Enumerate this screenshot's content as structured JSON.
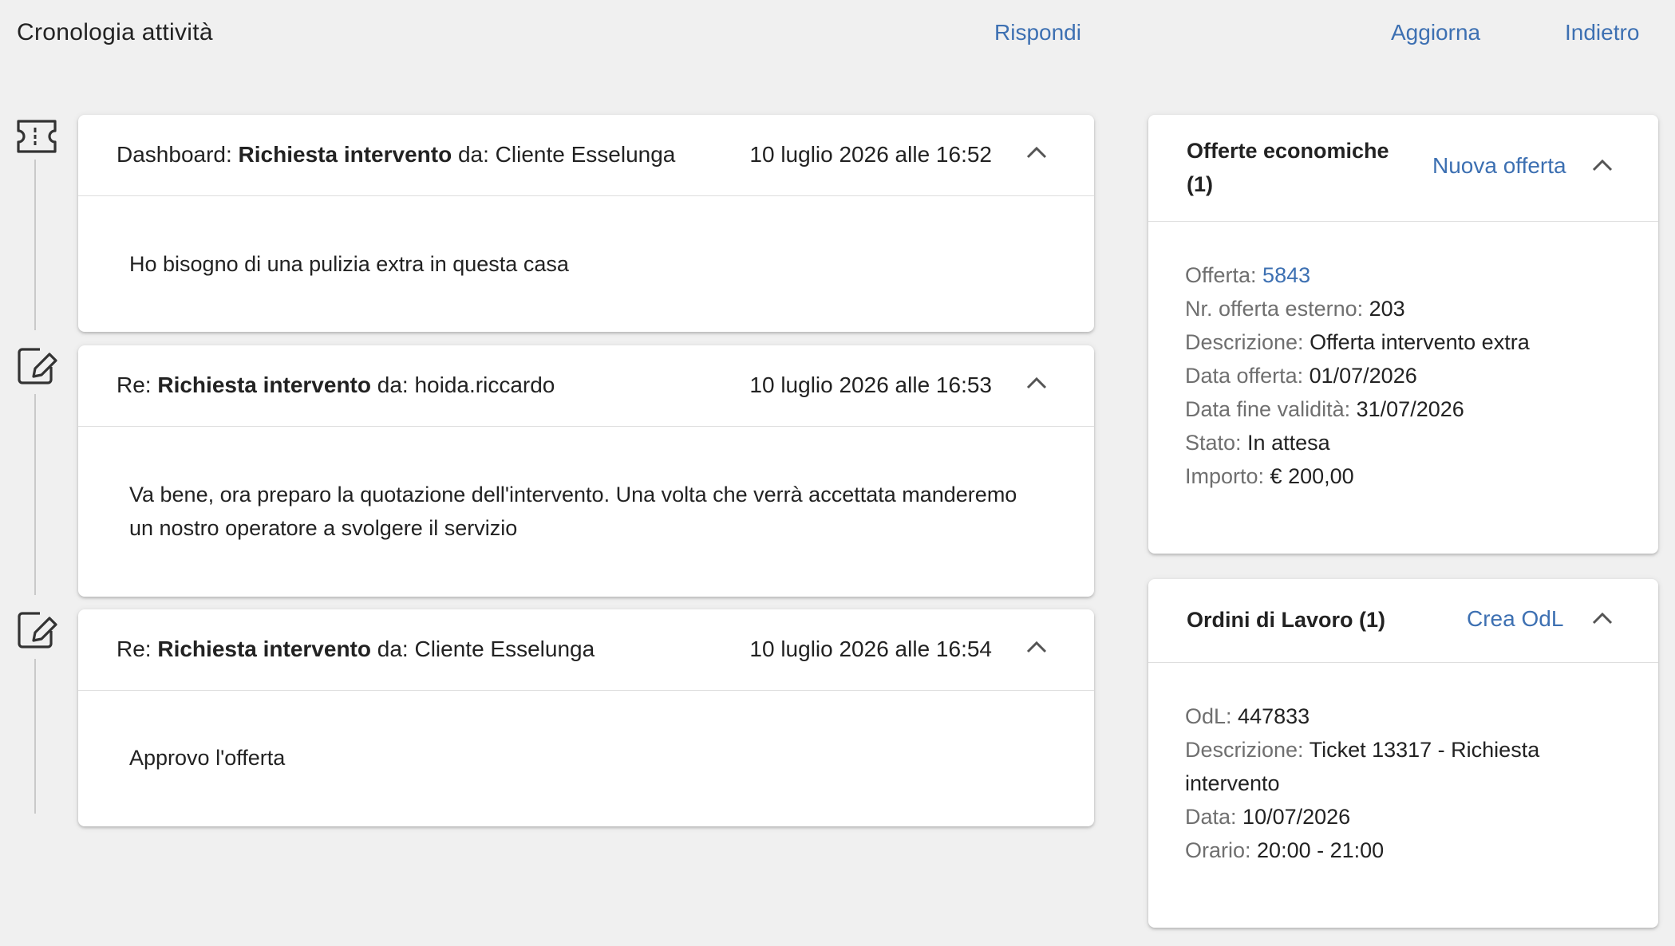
{
  "header": {
    "title": "Cronologia attività",
    "reply_label": "Rispondi",
    "refresh_label": "Aggiorna",
    "back_label": "Indietro"
  },
  "messages": [
    {
      "icon": "ticket-icon",
      "prefix": "Dashboard: ",
      "subject": "Richiesta intervento",
      "from_label": " da: ",
      "from": "Cliente Esselunga",
      "date": "10 luglio 2026 alle 16:52",
      "body": "Ho bisogno di una pulizia extra in questa casa"
    },
    {
      "icon": "edit-note-icon",
      "prefix": "Re: ",
      "subject": "Richiesta intervento",
      "from_label": " da: ",
      "from": "hoida.riccardo",
      "date": "10 luglio 2026 alle 16:53",
      "body": "Va bene, ora preparo la quotazione dell'intervento. Una volta che verrà accettata manderemo un nostro operatore a svolgere il servizio"
    },
    {
      "icon": "edit-note-icon",
      "prefix": "Re: ",
      "subject": "Richiesta intervento",
      "from_label": " da: ",
      "from": "Cliente Esselunga",
      "date": "10 luglio 2026 alle 16:54",
      "body": "Approvo l'offerta"
    }
  ],
  "offers": {
    "title": "Offerte economiche (1)",
    "action_label": "Nuova offerta",
    "fields": [
      {
        "label": "Offerta: ",
        "value": "5843"
      },
      {
        "label": "Nr. offerta esterno: ",
        "value": "203"
      },
      {
        "label": "Descrizione: ",
        "value": "Offerta intervento extra"
      },
      {
        "label": "Data offerta: ",
        "value": "01/07/2026"
      },
      {
        "label": "Data fine validità: ",
        "value": "31/07/2026"
      },
      {
        "label": "Stato: ",
        "value": "In attesa"
      },
      {
        "label": "Importo: ",
        "value": "€ 200,00"
      }
    ]
  },
  "work_orders": {
    "title": "Ordini di Lavoro (1)",
    "action_label": "Crea OdL",
    "fields": [
      {
        "label": "OdL: ",
        "value": "447833"
      },
      {
        "label": "Descrizione: ",
        "value": "Ticket 13317 - Richiesta intervento"
      },
      {
        "label": "Data: ",
        "value": "10/07/2026"
      },
      {
        "label": "Orario: ",
        "value": "20:00 - 21:00"
      }
    ]
  },
  "colors": {
    "link": "#3d70b2",
    "background": "#f0f0f0",
    "label_gray": "#6f6f6f"
  }
}
